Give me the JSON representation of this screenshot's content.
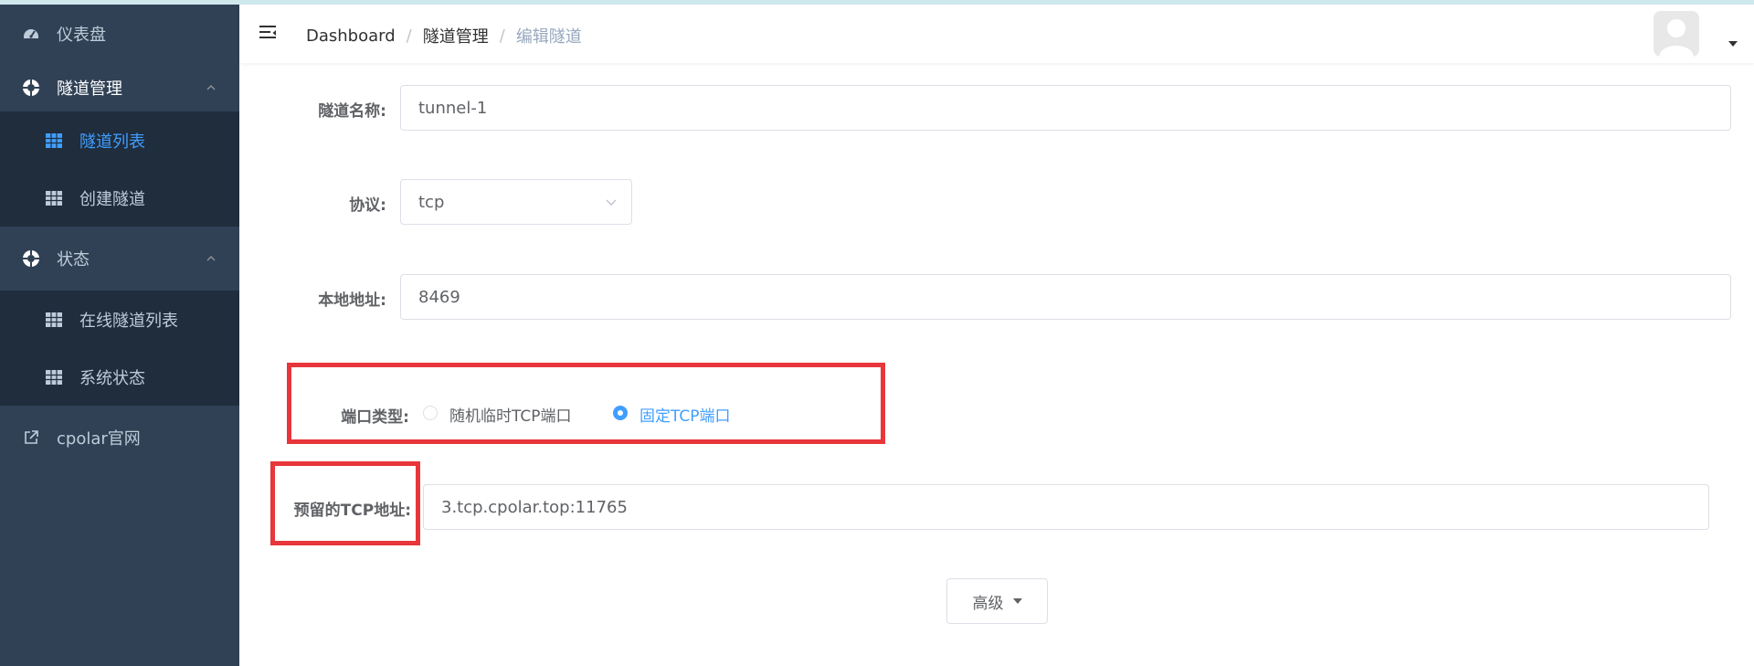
{
  "sidebar": {
    "dashboard": "仪表盘",
    "tunnel_mgmt": "隧道管理",
    "tunnel_list": "隧道列表",
    "create_tunnel": "创建隧道",
    "status": "状态",
    "online_tunnels": "在线隧道列表",
    "system_status": "系统状态",
    "cpolar_site": "cpolar官网"
  },
  "header": {
    "breadcrumb": [
      "Dashboard",
      "隧道管理",
      "编辑隧道"
    ],
    "separator": "/"
  },
  "form": {
    "tunnel_name_label": "隧道名称:",
    "tunnel_name_value": "tunnel-1",
    "protocol_label": "协议:",
    "protocol_value": "tcp",
    "local_addr_label": "本地地址:",
    "local_addr_value": "8469",
    "port_type_label": "端口类型:",
    "port_type_options": [
      "随机临时TCP端口",
      "固定TCP端口"
    ],
    "port_type_selected": "固定TCP端口",
    "reserved_tcp_label": "预留的TCP地址:",
    "reserved_tcp_value": "3.tcp.cpolar.top:11765",
    "advanced_button": "高级"
  },
  "colors": {
    "sidebar_bg": "#304156",
    "submenu_bg": "#1f2d3d",
    "accent": "#409eff",
    "highlight_box": "#e8363b"
  }
}
